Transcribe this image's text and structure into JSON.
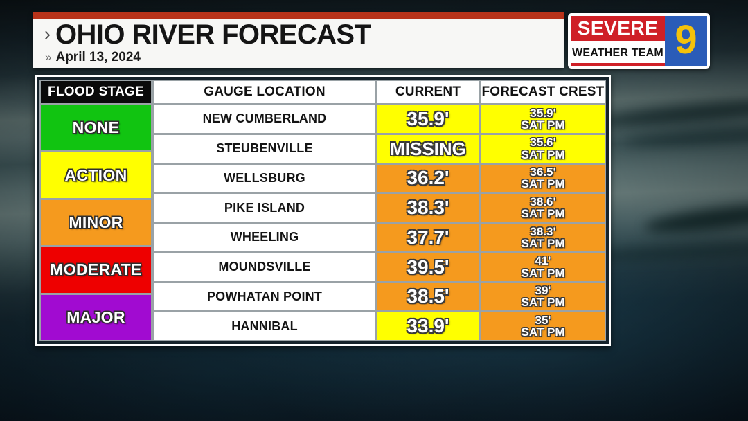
{
  "header": {
    "title": "OHIO RIVER FORECAST",
    "date": "April 13, 2024",
    "chevron_primary": "›",
    "chevron_secondary": "»"
  },
  "logo": {
    "line1": "SEVERE",
    "line2": "WEATHER TEAM",
    "channel": "9",
    "colors": {
      "red": "#cf2027",
      "blue": "#2a5cb8",
      "yellow": "#f5c20a",
      "white": "#ffffff"
    }
  },
  "table": {
    "headers": {
      "flood_stage": "FLOOD STAGE",
      "gauge_location": "GAUGE LOCATION",
      "current": "CURRENT",
      "forecast_crest": "FORECAST CREST"
    },
    "legend": [
      {
        "label": "NONE",
        "color": "#11c411"
      },
      {
        "label": "ACTION",
        "color": "#ffff00"
      },
      {
        "label": "MINOR",
        "color": "#f59a1e"
      },
      {
        "label": "MODERATE",
        "color": "#ee0000"
      },
      {
        "label": "MAJOR",
        "color": "#a10bd1"
      }
    ],
    "rows": [
      {
        "location": "NEW CUMBERLAND",
        "current": "35.9'",
        "current_color": "#ffff00",
        "crest_value": "35.9'",
        "crest_time": "SAT PM",
        "crest_color": "#ffff00"
      },
      {
        "location": "STEUBENVILLE",
        "current": "MISSING",
        "current_color": "#ffff00",
        "crest_value": "35.6'",
        "crest_time": "SAT PM",
        "crest_color": "#ffff00"
      },
      {
        "location": "WELLSBURG",
        "current": "36.2'",
        "current_color": "#f59a1e",
        "crest_value": "36.5'",
        "crest_time": "SAT PM",
        "crest_color": "#f59a1e"
      },
      {
        "location": "PIKE ISLAND",
        "current": "38.3'",
        "current_color": "#f59a1e",
        "crest_value": "38.6'",
        "crest_time": "SAT PM",
        "crest_color": "#f59a1e"
      },
      {
        "location": "WHEELING",
        "current": "37.7'",
        "current_color": "#f59a1e",
        "crest_value": "38.3'",
        "crest_time": "SAT PM",
        "crest_color": "#f59a1e"
      },
      {
        "location": "MOUNDSVILLE",
        "current": "39.5'",
        "current_color": "#f59a1e",
        "crest_value": "41'",
        "crest_time": "SAT PM",
        "crest_color": "#f59a1e"
      },
      {
        "location": "POWHATAN POINT",
        "current": "38.5'",
        "current_color": "#f59a1e",
        "crest_value": "39'",
        "crest_time": "SAT PM",
        "crest_color": "#f59a1e"
      },
      {
        "location": "HANNIBAL",
        "current": "33.9'",
        "current_color": "#ffff00",
        "crest_value": "35'",
        "crest_time": "SAT PM",
        "crest_color": "#f59a1e"
      }
    ]
  }
}
